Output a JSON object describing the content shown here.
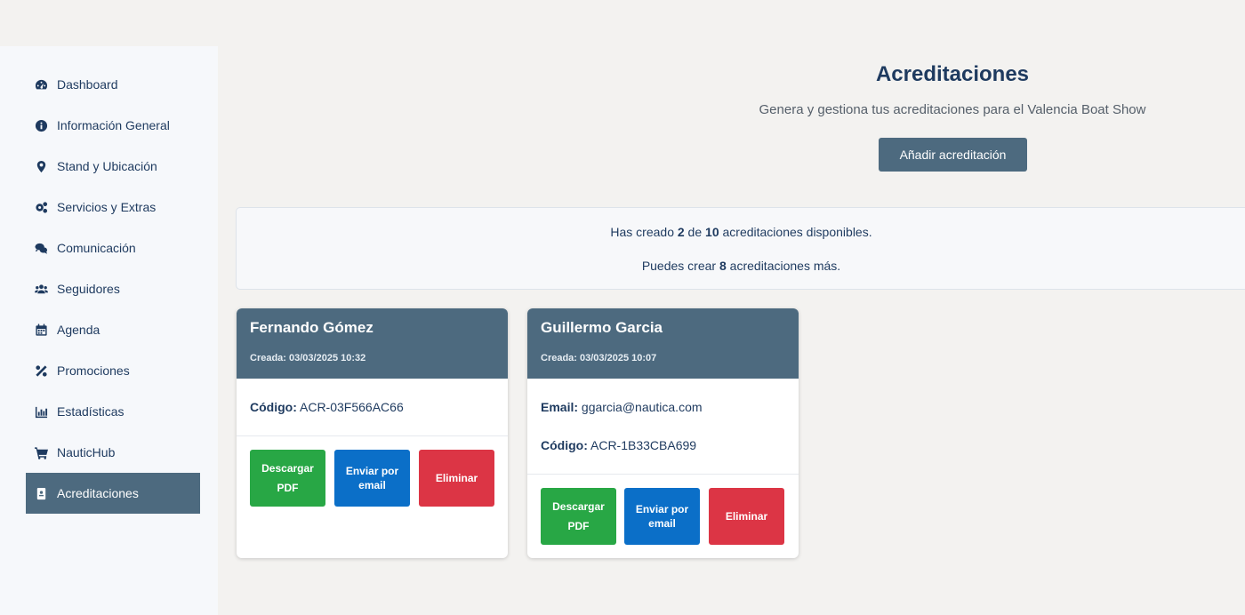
{
  "sidebar": {
    "items": [
      {
        "label": "Dashboard",
        "icon": "dashboard-icon"
      },
      {
        "label": "Información General",
        "icon": "info-icon"
      },
      {
        "label": "Stand y Ubicación",
        "icon": "map-marker-icon"
      },
      {
        "label": "Servicios y Extras",
        "icon": "gears-icon"
      },
      {
        "label": "Comunicación",
        "icon": "comments-icon"
      },
      {
        "label": "Seguidores",
        "icon": "users-icon"
      },
      {
        "label": "Agenda",
        "icon": "calendar-icon"
      },
      {
        "label": "Promociones",
        "icon": "percent-icon"
      },
      {
        "label": "Estadísticas",
        "icon": "chart-icon"
      },
      {
        "label": "NauticHub",
        "icon": "cart-icon"
      },
      {
        "label": "Acreditaciones",
        "icon": "badge-icon",
        "active": true
      }
    ]
  },
  "header": {
    "title": "Acreditaciones",
    "subtitle": "Genera y gestiona tus acreditaciones para el Valencia Boat Show",
    "add_button": "Añadir acreditación"
  },
  "summary": {
    "line1_prefix": "Has creado ",
    "created": "2",
    "line1_mid": " de ",
    "total": "10",
    "line1_suffix": " acreditaciones disponibles.",
    "line2_prefix": "Puedes crear ",
    "remaining": "8",
    "line2_suffix": " acreditaciones más."
  },
  "cards": [
    {
      "name": "Fernando Gómez",
      "created": "Creada: 03/03/2025 10:32",
      "code_label": "Código:",
      "code": "ACR-03F566AC66",
      "download": "Descargar PDF",
      "send": "Enviar por email",
      "delete": "Eliminar"
    },
    {
      "name": "Guillermo Garcia",
      "created": "Creada: 03/03/2025 10:07",
      "email_label": "Email:",
      "email": "ggarcia@nautica.com",
      "code_label": "Código:",
      "code": "ACR-1B33CBA699",
      "download": "Descargar PDF",
      "send": "Enviar por email",
      "delete": "Eliminar"
    }
  ],
  "colors": {
    "primary": "#4d6a7f",
    "text": "#1e3a5f",
    "success": "#28a745",
    "info": "#0b6fc8",
    "danger": "#dc3545"
  }
}
